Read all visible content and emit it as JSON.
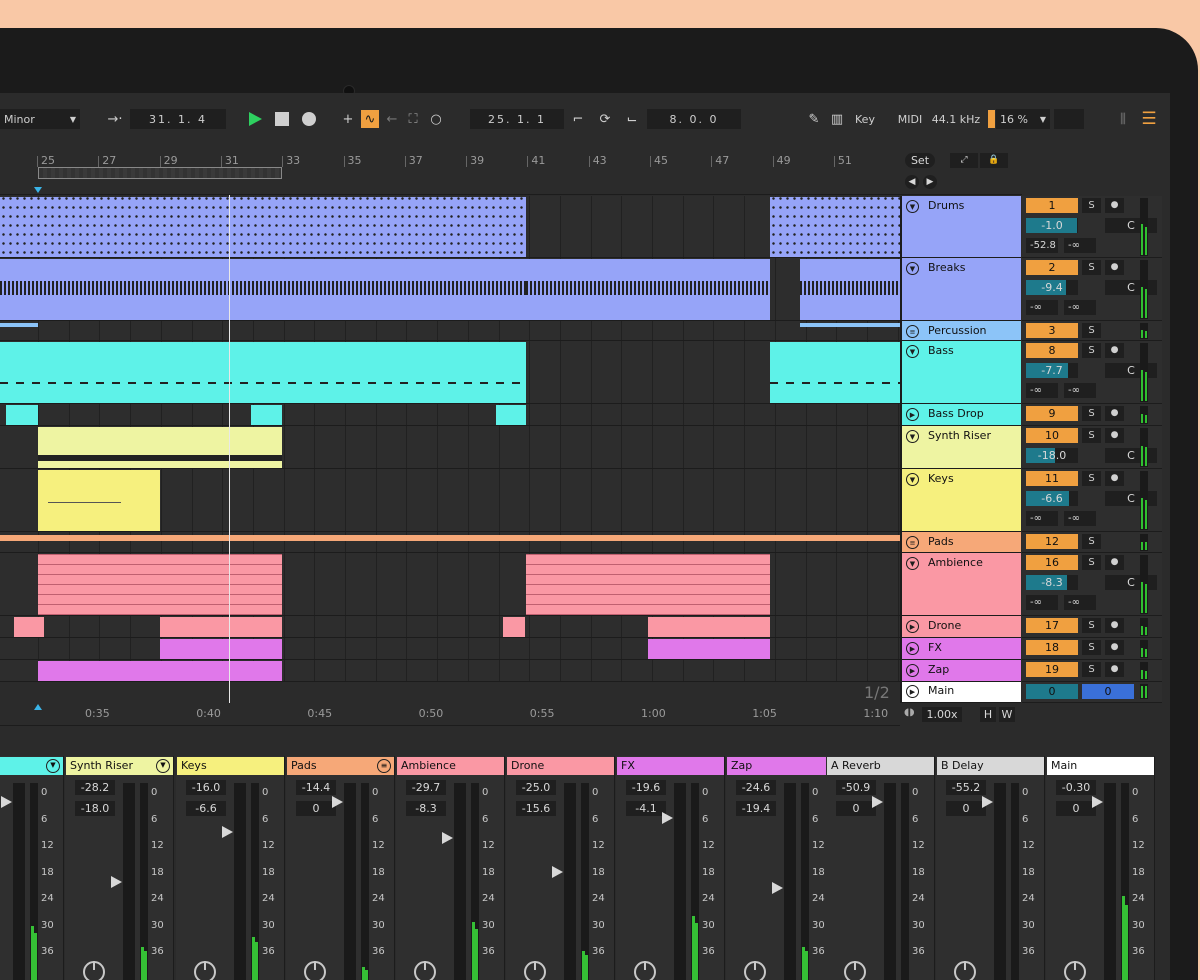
{
  "transport": {
    "scale": "Minor",
    "position": "31.  1.  4",
    "loop_start": "25.  1.  1",
    "loop_length": "8.  0.  0",
    "key_label": "Key",
    "midi_label": "MIDI",
    "sample_rate": "44.1 kHz",
    "cpu": "16 %"
  },
  "ruler": {
    "bars": [
      "25",
      "27",
      "29",
      "31",
      "33",
      "35",
      "37",
      "39",
      "41",
      "43",
      "45",
      "47",
      "49",
      "51"
    ],
    "set_label": "Set"
  },
  "tracks": [
    {
      "name": "Drums",
      "num": "1",
      "vol": "-1.0",
      "pan": "C",
      "send_a": "-52.8",
      "send_b": "-∞",
      "color": "#96a4f8"
    },
    {
      "name": "Breaks",
      "num": "2",
      "vol": "-9.4",
      "pan": "C",
      "send_a": "-∞",
      "send_b": "-∞",
      "color": "#96a4f8"
    },
    {
      "name": "Percussion",
      "num": "3",
      "color": "#8cc4f8"
    },
    {
      "name": "Bass",
      "num": "8",
      "vol": "-7.7",
      "pan": "C",
      "send_a": "-∞",
      "send_b": "-∞",
      "color": "#5ef2e8"
    },
    {
      "name": "Bass Drop",
      "num": "9",
      "color": "#5ef2e8"
    },
    {
      "name": "Synth Riser",
      "num": "10",
      "vol": "-18.0",
      "pan": "C",
      "color": "#eef4a2"
    },
    {
      "name": "Keys",
      "num": "11",
      "vol": "-6.6",
      "pan": "C",
      "send_a": "-∞",
      "send_b": "-∞",
      "color": "#f6f07e"
    },
    {
      "name": "Pads",
      "num": "12",
      "color": "#f6a878"
    },
    {
      "name": "Ambience",
      "num": "16",
      "vol": "-8.3",
      "pan": "C",
      "send_a": "-∞",
      "send_b": "-∞",
      "color": "#fa98a4"
    },
    {
      "name": "Drone",
      "num": "17",
      "color": "#fa98a4"
    },
    {
      "name": "FX",
      "num": "18",
      "color": "#e078ea"
    },
    {
      "name": "Zap",
      "num": "19",
      "color": "#e078ea"
    }
  ],
  "main_track": {
    "name": "Main",
    "send_a": "0",
    "send_b": "0",
    "page": "1/2",
    "zoom": "1.00x",
    "h": "H",
    "w": "W"
  },
  "timeline": [
    "0:35",
    "0:40",
    "0:45",
    "0:50",
    "0:55",
    "1:00",
    "1:05",
    "1:10"
  ],
  "mixer": [
    {
      "name": "rop",
      "top": "",
      "bottom": "",
      "color": "#5ef2e8",
      "scale": [
        "0",
        "6",
        "12",
        "18",
        "24",
        "30",
        "36"
      ]
    },
    {
      "name": "Synth Riser",
      "top": "-28.2",
      "bottom": "-18.0",
      "color": "#eef4a2",
      "scale": [
        "0",
        "6",
        "12",
        "18",
        "24",
        "30",
        "36"
      ]
    },
    {
      "name": "Keys",
      "top": "-16.0",
      "bottom": "-6.6",
      "color": "#f6f07e",
      "scale": [
        "0",
        "6",
        "12",
        "18",
        "24",
        "30",
        "36"
      ]
    },
    {
      "name": "Pads",
      "top": "-14.4",
      "bottom": "0",
      "color": "#f6a878",
      "scale": [
        "0",
        "6",
        "12",
        "18",
        "24",
        "30",
        "36"
      ]
    },
    {
      "name": "Ambience",
      "top": "-29.7",
      "bottom": "-8.3",
      "color": "#fa98a4",
      "scale": [
        "0",
        "6",
        "12",
        "18",
        "24",
        "30",
        "36"
      ]
    },
    {
      "name": "Drone",
      "top": "-25.0",
      "bottom": "-15.6",
      "color": "#fa98a4",
      "scale": [
        "0",
        "6",
        "12",
        "18",
        "24",
        "30",
        "36"
      ]
    },
    {
      "name": "FX",
      "top": "-19.6",
      "bottom": "-4.1",
      "color": "#e078ea",
      "scale": [
        "0",
        "6",
        "12",
        "18",
        "24",
        "30",
        "36"
      ]
    },
    {
      "name": "Zap",
      "top": "-24.6",
      "bottom": "-19.4",
      "color": "#e078ea",
      "scale": [
        "0",
        "6",
        "12",
        "18",
        "24",
        "30",
        "36"
      ]
    },
    {
      "name": "A Reverb",
      "top": "-50.9",
      "bottom": "0",
      "color": "#d8d8d8",
      "scale": [
        "0",
        "6",
        "12",
        "18",
        "24",
        "30",
        "36"
      ]
    },
    {
      "name": "B Delay",
      "top": "-55.2",
      "bottom": "0",
      "color": "#d8d8d8",
      "scale": [
        "0",
        "6",
        "12",
        "18",
        "24",
        "30",
        "36"
      ]
    },
    {
      "name": "Main",
      "top": "-0.30",
      "bottom": "0",
      "color": "#ffffff",
      "scale": [
        "0",
        "6",
        "12",
        "18",
        "24",
        "30",
        "36"
      ]
    }
  ]
}
